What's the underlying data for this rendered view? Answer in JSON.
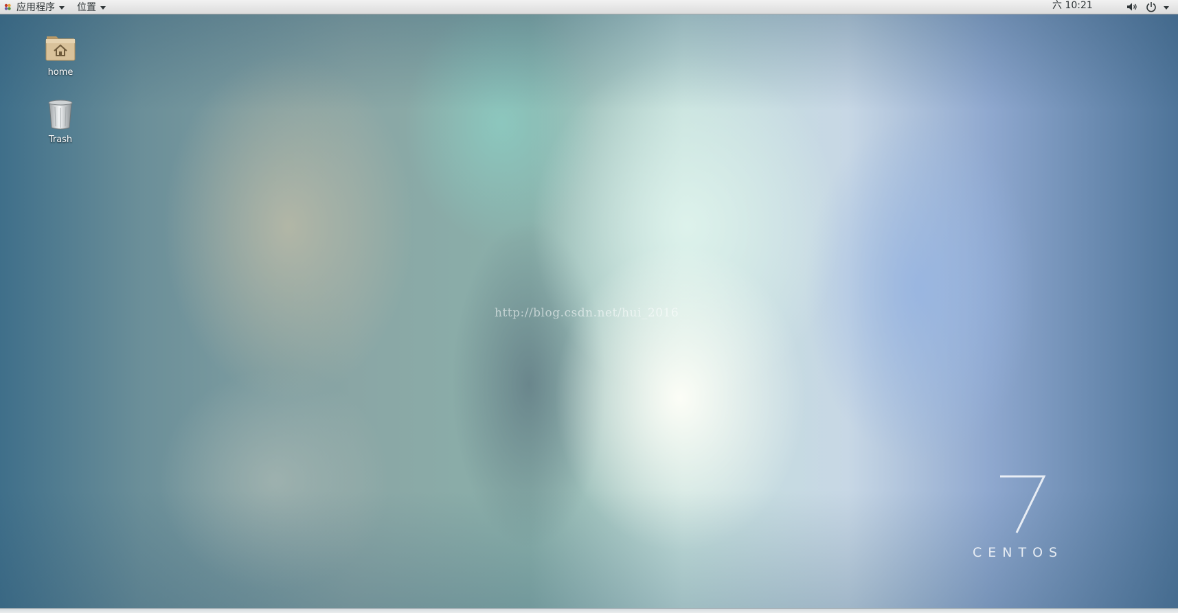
{
  "top_panel": {
    "applications_label": "应用程序",
    "places_label": "位置",
    "clock": "六 10:21"
  },
  "desktop": {
    "icons": [
      {
        "label": "home",
        "icon": "home-folder-icon"
      },
      {
        "label": "Trash",
        "icon": "trash-icon"
      }
    ],
    "watermark": "http://blog.csdn.net/hui_2016",
    "logo": {
      "number": "7",
      "text": "CENTOS"
    }
  },
  "colors": {
    "panel_bg": "#dcdcdc",
    "panel_text": "#2e3436",
    "folder": "#d9c29a",
    "logo": "#ffffff"
  }
}
